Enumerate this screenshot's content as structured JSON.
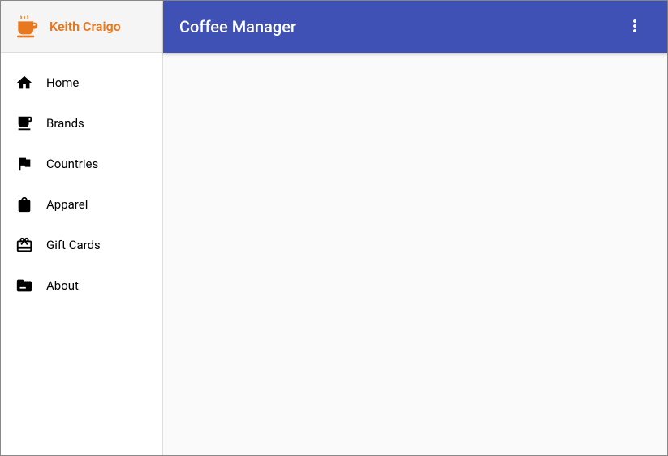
{
  "brand": {
    "name": "Keith Craigo",
    "accent_color": "#e8781f"
  },
  "topbar": {
    "title": "Coffee Manager",
    "primary_color": "#3f51b5"
  },
  "sidebar": {
    "items": [
      {
        "label": "Home",
        "icon": "home-icon"
      },
      {
        "label": "Brands",
        "icon": "coffee-cup-icon"
      },
      {
        "label": "Countries",
        "icon": "flag-icon"
      },
      {
        "label": "Apparel",
        "icon": "shopping-bag-icon"
      },
      {
        "label": "Gift Cards",
        "icon": "gift-card-icon"
      },
      {
        "label": "About",
        "icon": "folder-icon"
      }
    ]
  }
}
